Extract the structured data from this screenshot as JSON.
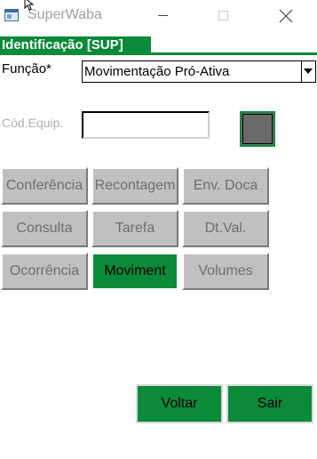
{
  "window": {
    "title": "SuperWaba"
  },
  "header": {
    "title": "Identificação [SUP]"
  },
  "form": {
    "funcao_label": "Função*",
    "funcao_value": "Movimentação Pró-Ativa",
    "cod_equip_label": "Cód.Equip.",
    "cod_equip_value": ""
  },
  "buttons": {
    "conferencia": "Conferência",
    "recontagem": "Recontagem",
    "env_doca": "Env. Doca",
    "consulta": "Consulta",
    "tarefa": "Tarefa",
    "dt_val": "Dt.Val.",
    "ocorrencia": "Ocorrência",
    "moviment": "Moviment",
    "volumes": "Volumes",
    "voltar": "Voltar",
    "sair": "Sair"
  },
  "colors": {
    "accent_green": "#0b8a3a",
    "button_gray": "#c0c0c0"
  }
}
